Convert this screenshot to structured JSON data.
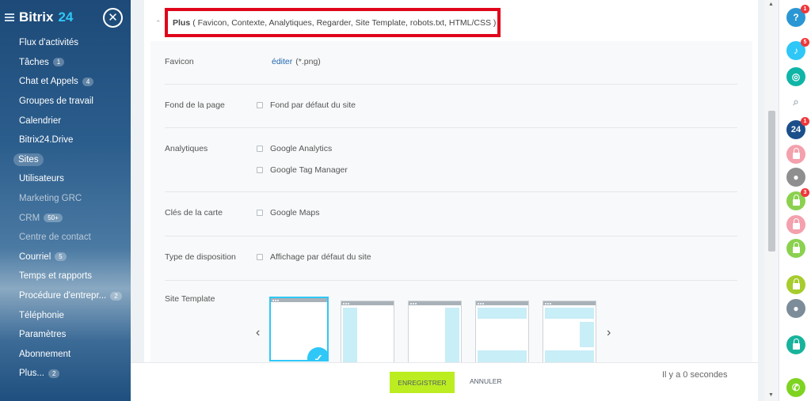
{
  "sidebar": {
    "brand_name": "Bitrix",
    "brand_num": "24",
    "items": [
      {
        "label": "Flux d'activités"
      },
      {
        "label": "Tâches",
        "badge": "1"
      },
      {
        "label": "Chat et Appels",
        "badge": "4"
      },
      {
        "label": "Groupes de travail"
      },
      {
        "label": "Calendrier"
      },
      {
        "label": "Bitrix24.Drive"
      },
      {
        "label": "Sites"
      },
      {
        "label": "Utilisateurs"
      },
      {
        "label": "Marketing GRC"
      },
      {
        "label": "CRM",
        "badge": "50+"
      },
      {
        "label": "Centre de contact"
      },
      {
        "label": "Courriel",
        "badge": "5"
      },
      {
        "label": "Temps et rapports"
      },
      {
        "label": "Procédure d'entrepr...",
        "badge": "2"
      },
      {
        "label": "Téléphonie"
      },
      {
        "label": "Paramètres"
      },
      {
        "label": "Abonnement"
      },
      {
        "label": "Plus...",
        "badge": "2"
      }
    ]
  },
  "plus_header": {
    "title": "Plus",
    "items": "( Favicon,  Contexte,  Analytiques,  Regarder,  Site Template,  robots.txt,  HTML/CSS )"
  },
  "form": {
    "favicon": {
      "label": "Favicon",
      "edit_link": "éditer",
      "hint": "(*.png)"
    },
    "background": {
      "label": "Fond de la page",
      "option": "Fond par défaut du site"
    },
    "analytics": {
      "label": "Analytiques",
      "options": [
        "Google Analytics",
        "Google Tag Manager"
      ]
    },
    "map_keys": {
      "label": "Clés de la carte",
      "option": "Google Maps"
    },
    "layout_type": {
      "label": "Type de disposition",
      "option": "Affichage par défaut du site"
    },
    "site_template": {
      "label": "Site Template"
    }
  },
  "footer": {
    "save_label": "ENREGISTRER",
    "cancel_label": "ANNULER",
    "saved_time": "Il y a 0 secondes"
  },
  "right_panel": {
    "help_badge": "1",
    "notifications_badge": "5",
    "b24_badge": "1",
    "lock3_badge": "3"
  },
  "colors": {
    "accent": "#2fc7f7",
    "save_button": "#bbed21",
    "highlight_frame": "#e0051b",
    "link": "#2067b0"
  }
}
